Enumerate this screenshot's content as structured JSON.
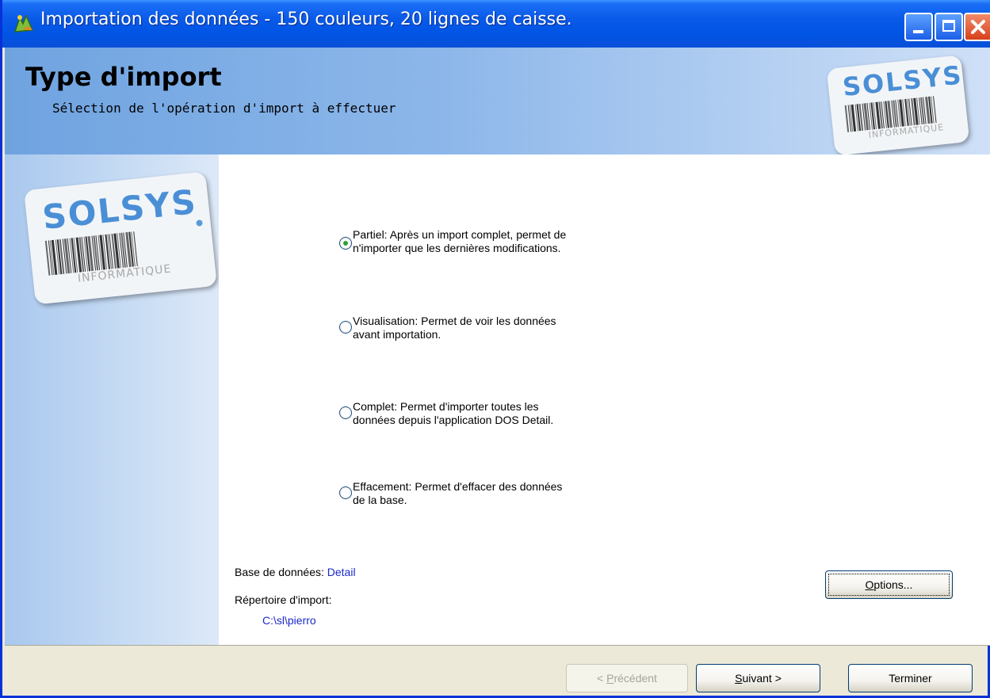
{
  "window": {
    "title": "Importation des données - 150 couleurs, 20 lignes de caisse."
  },
  "header": {
    "title": "Type d'import",
    "subtitle": "Sélection de l'opération d'import à effectuer"
  },
  "logo": {
    "brand": "SOLSYS",
    "tagline": "INFORMATIQUE"
  },
  "options": [
    {
      "line1": "Partiel: Après un import complet, permet de",
      "line2": "n'importer que les dernières modifications.",
      "checked": true
    },
    {
      "line1": "Visualisation: Permet de voir les données",
      "line2": "avant importation.",
      "checked": false
    },
    {
      "line1": "Complet: Permet d'importer toutes les",
      "line2": "données depuis l'application DOS Detail.",
      "checked": false
    },
    {
      "line1": "Effacement: Permet d'effacer des données",
      "line2": "de la base.",
      "checked": false
    }
  ],
  "info": {
    "database_label": "Base de données:",
    "database_value": "Detail",
    "import_dir_label": "Répertoire d'import:",
    "import_dir_value": "C:\\sl\\pierro"
  },
  "buttons": {
    "options": {
      "accel": "O",
      "rest": "ptions..."
    },
    "previous": {
      "prefix": "< ",
      "accel": "P",
      "rest": "récédent"
    },
    "next": {
      "accel": "S",
      "rest": "uivant >"
    },
    "finish": "Terminer"
  }
}
